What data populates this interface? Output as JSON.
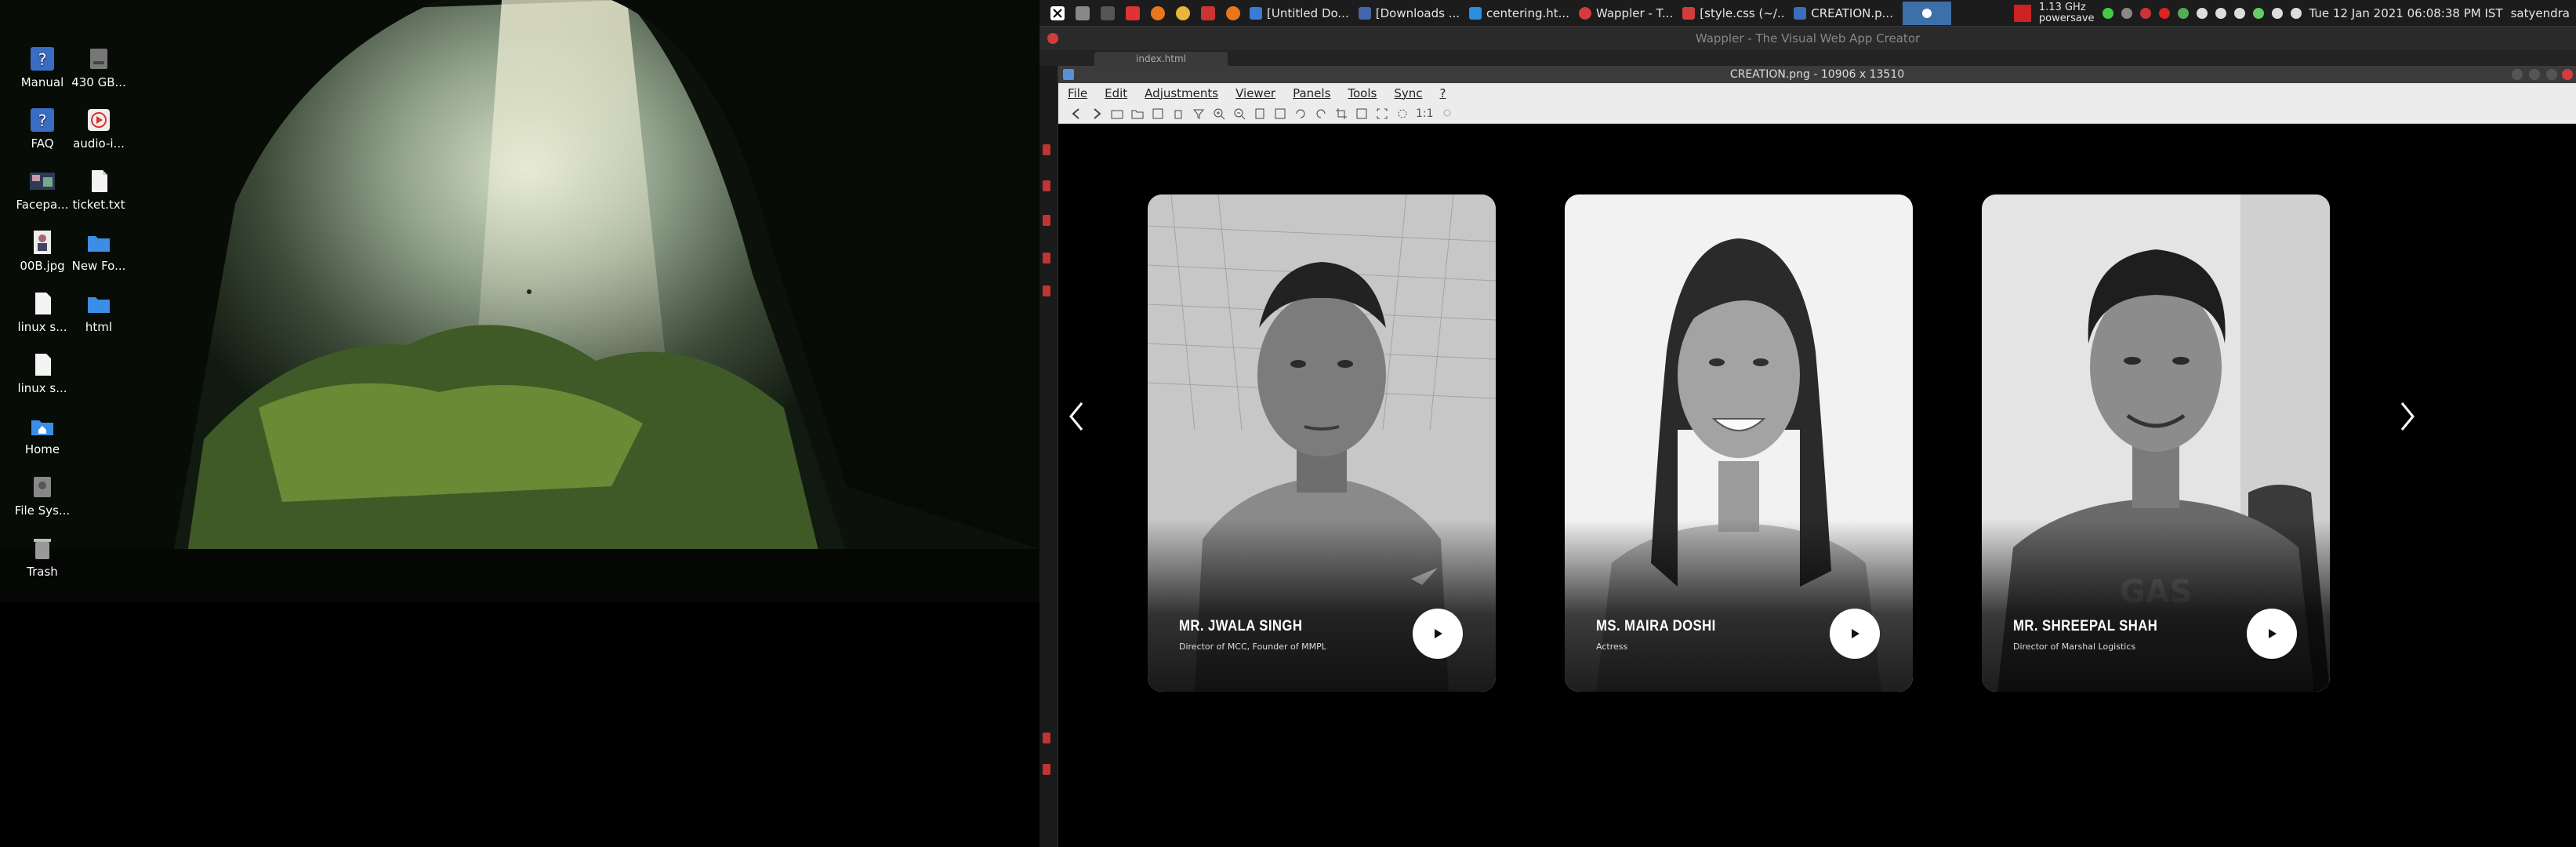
{
  "desktop": {
    "icons": [
      {
        "label": "Manual",
        "icon": "help-icon"
      },
      {
        "label": "430 GB...",
        "icon": "drive-icon"
      },
      {
        "label": "FAQ",
        "icon": "help-icon"
      },
      {
        "label": "audio-i...",
        "icon": "audio-icon"
      },
      {
        "label": "Facepa...",
        "icon": "image-icon"
      },
      {
        "label": "ticket.txt",
        "icon": "text-file-icon"
      },
      {
        "label": "00B.jpg",
        "icon": "image-icon"
      },
      {
        "label": "New Fo...",
        "icon": "folder-icon"
      },
      {
        "label": "linux s...",
        "icon": "text-file-icon"
      },
      {
        "label": "html",
        "icon": "folder-icon"
      },
      {
        "label": "linux s...",
        "icon": "text-file-icon"
      },
      {
        "label": "Home",
        "icon": "home-icon"
      },
      {
        "label": "File Sys...",
        "icon": "drive-icon"
      },
      {
        "label": "Trash",
        "icon": "trash-icon"
      }
    ]
  },
  "taskbar": {
    "tasks": [
      "[Untitled Do...",
      "[Downloads ...",
      "centering.ht...",
      "Wappler - T...",
      "[style.css (~/...",
      "CREATION.p..."
    ],
    "cpu_freq": "1.13 GHz",
    "cpu_mode": "powersave",
    "clock": "Tue 12 Jan 2021 06:08:38 PM IST",
    "user": "satyendra"
  },
  "wappler": {
    "title": "Wappler - The Visual Web App Creator",
    "tab": "index.html"
  },
  "viewer": {
    "title": "CREATION.png - 10906 x 13510",
    "menu": [
      "File",
      "Edit",
      "Adjustments",
      "Viewer",
      "Panels",
      "Tools",
      "Sync",
      "?"
    ],
    "zoom_label": "1:1"
  },
  "cards": [
    {
      "name": "MR. JWALA SINGH",
      "role": "Director of MCC,  Founder of MMPL"
    },
    {
      "name": "MS. MAIRA DOSHI",
      "role": "Actress"
    },
    {
      "name": "MR. SHREEPAL SHAH",
      "role": "Director of Marshal Logistics"
    }
  ],
  "colors": {
    "accent": "#3d6fa8",
    "alert": "#c23333",
    "taskbar_bg": "#1c1c1c"
  }
}
